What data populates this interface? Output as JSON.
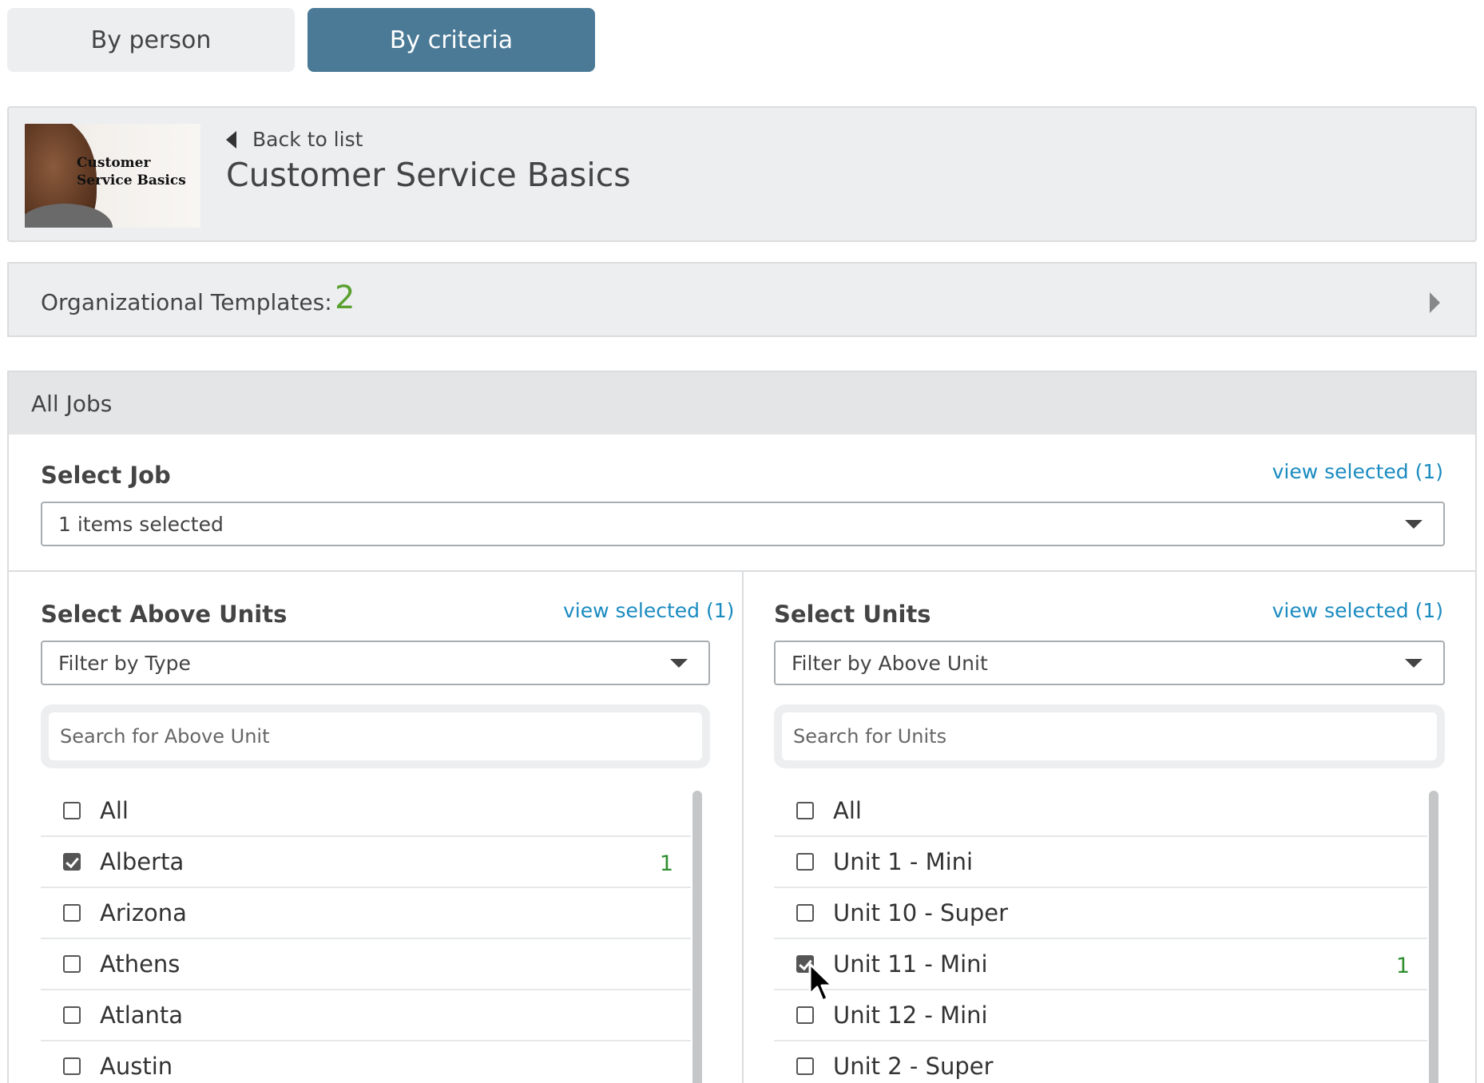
{
  "tabs": {
    "by_person": "By person",
    "by_criteria": "By criteria",
    "active": "By criteria"
  },
  "course": {
    "thumbnail_text": "Customer Service Basics",
    "back_label": "Back to list",
    "title": "Customer Service Basics"
  },
  "org_templates": {
    "label": "Organizational Templates:",
    "count": "2"
  },
  "jobs": {
    "header": "All Jobs",
    "select_job_title": "Select Job",
    "view_selected": "view selected (1)",
    "select_value": "1 items selected"
  },
  "above_units": {
    "title": "Select Above Units",
    "view_selected": "view selected (1)",
    "filter_value": "Filter by Type",
    "search_placeholder": "Search for Above Unit",
    "items": [
      {
        "label": "All",
        "checked": false,
        "count": ""
      },
      {
        "label": "Alberta",
        "checked": true,
        "count": "1"
      },
      {
        "label": "Arizona",
        "checked": false,
        "count": ""
      },
      {
        "label": "Athens",
        "checked": false,
        "count": ""
      },
      {
        "label": "Atlanta",
        "checked": false,
        "count": ""
      },
      {
        "label": "Austin",
        "checked": false,
        "count": ""
      }
    ]
  },
  "units": {
    "title": "Select Units",
    "view_selected": "view selected (1)",
    "filter_value": "Filter by Above Unit",
    "search_placeholder": "Search for Units",
    "items": [
      {
        "label": "All",
        "checked": false,
        "count": ""
      },
      {
        "label": "Unit 1 - Mini",
        "checked": false,
        "count": ""
      },
      {
        "label": "Unit 10 - Super",
        "checked": false,
        "count": ""
      },
      {
        "label": "Unit 11 - Mini",
        "checked": true,
        "count": "1"
      },
      {
        "label": "Unit 12 - Mini",
        "checked": false,
        "count": ""
      },
      {
        "label": "Unit 2 - Super",
        "checked": false,
        "count": ""
      }
    ]
  },
  "colors": {
    "active_tab": "#4a7a96",
    "link": "#1a8bc0",
    "count_green": "#5aa130"
  }
}
